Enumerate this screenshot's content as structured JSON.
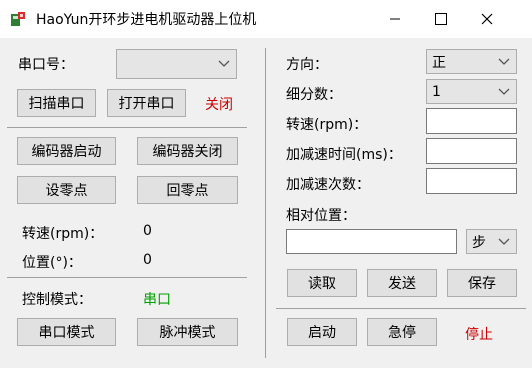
{
  "window": {
    "title": "HaoYun开环步进电机驱动器上位机",
    "minimize_glyph": "minimize-icon",
    "maximize_glyph": "maximize-icon",
    "close_glyph": "close-icon"
  },
  "left": {
    "port_label": "串口号：",
    "port_value": "",
    "scan_button": "扫描串口",
    "open_button": "打开串口",
    "port_status": "关闭",
    "encoder_on_button": "编码器启动",
    "encoder_off_button": "编码器关闭",
    "set_zero_button": "设零点",
    "return_zero_button": "回零点",
    "speed_label": "转速(rpm)：",
    "speed_value": "0",
    "position_label": "位置(°)：",
    "position_value": "0",
    "control_mode_label": "控制模式：",
    "control_mode_value": "串口",
    "serial_mode_button": "串口模式",
    "pulse_mode_button": "脉冲模式"
  },
  "right": {
    "direction_label": "方向：",
    "direction_value": "正",
    "microstep_label": "细分数：",
    "microstep_value": "1",
    "speed_label": "转速(rpm)：",
    "speed_value": "",
    "accel_time_label": "加减速时间(ms)：",
    "accel_time_value": "",
    "accel_count_label": "加减速次数：",
    "accel_count_value": "",
    "relative_position_label": "相对位置：",
    "relative_position_value": "",
    "unit_value": "步",
    "read_button": "读取",
    "send_button": "发送",
    "save_button": "保存",
    "start_button": "启动",
    "estop_button": "急停",
    "stop_status": "停止"
  },
  "colors": {
    "status_red": "#cc0000",
    "status_green": "#00a000"
  }
}
